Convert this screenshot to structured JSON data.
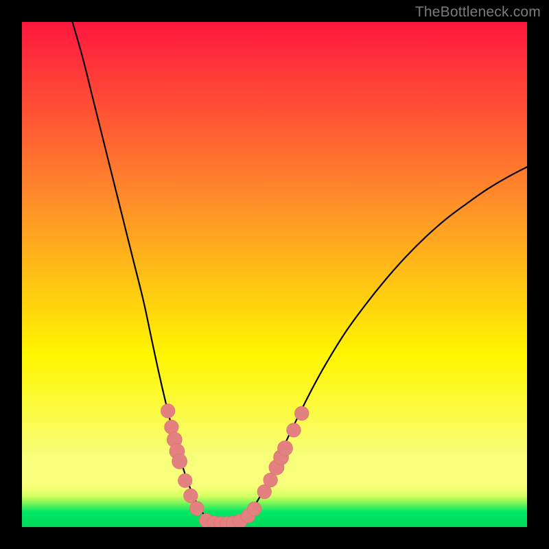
{
  "watermark": "TheBottleneck.com",
  "colors": {
    "frame": "#000000",
    "gradient_top": "#ff173f",
    "gradient_mid_upper": "#ff8c2a",
    "gradient_mid": "#fff600",
    "gradient_band": "#f8ff7a",
    "gradient_green": "#00e864",
    "curve": "#000000",
    "marker_fill": "#e38080",
    "marker_stroke": "#de6e6e"
  },
  "chart_data": {
    "type": "line",
    "title": "",
    "xlabel": "",
    "ylabel": "",
    "xlim": [
      0,
      100
    ],
    "ylim": [
      0,
      100
    ],
    "grid": false,
    "legend": false,
    "curves": {
      "description": "Two monotone curves forming a V; left branch descends steeply from top-left to a flat trough, right branch rises with decreasing slope toward top-right.",
      "left_branch": [
        {
          "x": 10.0,
          "y": 100.0
        },
        {
          "x": 12.0,
          "y": 93.0
        },
        {
          "x": 14.0,
          "y": 85.0
        },
        {
          "x": 16.0,
          "y": 77.0
        },
        {
          "x": 18.0,
          "y": 69.0
        },
        {
          "x": 20.0,
          "y": 61.0
        },
        {
          "x": 22.0,
          "y": 53.0
        },
        {
          "x": 24.0,
          "y": 45.0
        },
        {
          "x": 25.5,
          "y": 38.0
        },
        {
          "x": 27.0,
          "y": 31.0
        },
        {
          "x": 28.5,
          "y": 24.5
        },
        {
          "x": 30.0,
          "y": 18.5
        },
        {
          "x": 31.5,
          "y": 13.0
        },
        {
          "x": 33.0,
          "y": 8.5
        },
        {
          "x": 34.5,
          "y": 5.0
        },
        {
          "x": 36.0,
          "y": 2.5
        },
        {
          "x": 37.5,
          "y": 1.2
        },
        {
          "x": 39.0,
          "y": 0.6
        },
        {
          "x": 40.5,
          "y": 0.4
        }
      ],
      "right_branch": [
        {
          "x": 40.5,
          "y": 0.4
        },
        {
          "x": 42.0,
          "y": 0.6
        },
        {
          "x": 43.5,
          "y": 1.3
        },
        {
          "x": 45.0,
          "y": 2.8
        },
        {
          "x": 47.0,
          "y": 5.8
        },
        {
          "x": 49.0,
          "y": 9.8
        },
        {
          "x": 51.0,
          "y": 14.2
        },
        {
          "x": 54.0,
          "y": 20.5
        },
        {
          "x": 57.0,
          "y": 26.5
        },
        {
          "x": 60.0,
          "y": 32.0
        },
        {
          "x": 64.0,
          "y": 38.5
        },
        {
          "x": 68.0,
          "y": 44.0
        },
        {
          "x": 72.0,
          "y": 49.0
        },
        {
          "x": 76.0,
          "y": 53.5
        },
        {
          "x": 80.0,
          "y": 57.5
        },
        {
          "x": 84.0,
          "y": 61.0
        },
        {
          "x": 88.0,
          "y": 64.0
        },
        {
          "x": 92.0,
          "y": 66.8
        },
        {
          "x": 96.0,
          "y": 69.2
        },
        {
          "x": 100.0,
          "y": 71.3
        }
      ]
    },
    "markers": [
      {
        "x": 28.9,
        "y": 23.0,
        "r": 1.4
      },
      {
        "x": 29.6,
        "y": 19.8,
        "r": 1.4
      },
      {
        "x": 30.2,
        "y": 17.3,
        "r": 1.5
      },
      {
        "x": 30.7,
        "y": 15.0,
        "r": 1.5
      },
      {
        "x": 31.2,
        "y": 13.0,
        "r": 1.5
      },
      {
        "x": 32.3,
        "y": 9.2,
        "r": 1.4
      },
      {
        "x": 33.4,
        "y": 6.2,
        "r": 1.4
      },
      {
        "x": 34.6,
        "y": 3.7,
        "r": 1.4
      },
      {
        "x": 36.5,
        "y": 1.3,
        "r": 1.4
      },
      {
        "x": 38.1,
        "y": 0.8,
        "r": 1.4
      },
      {
        "x": 39.4,
        "y": 0.7,
        "r": 1.4
      },
      {
        "x": 40.6,
        "y": 0.7,
        "r": 1.4
      },
      {
        "x": 41.8,
        "y": 0.8,
        "r": 1.4
      },
      {
        "x": 43.2,
        "y": 1.2,
        "r": 1.4
      },
      {
        "x": 44.8,
        "y": 2.2,
        "r": 1.4
      },
      {
        "x": 46.0,
        "y": 3.6,
        "r": 1.4
      },
      {
        "x": 48.0,
        "y": 7.0,
        "r": 1.4
      },
      {
        "x": 49.2,
        "y": 9.3,
        "r": 1.4
      },
      {
        "x": 50.4,
        "y": 11.8,
        "r": 1.5
      },
      {
        "x": 51.3,
        "y": 13.8,
        "r": 1.5
      },
      {
        "x": 52.1,
        "y": 15.6,
        "r": 1.5
      },
      {
        "x": 53.8,
        "y": 19.2,
        "r": 1.4
      },
      {
        "x": 55.4,
        "y": 22.5,
        "r": 1.4
      }
    ]
  }
}
